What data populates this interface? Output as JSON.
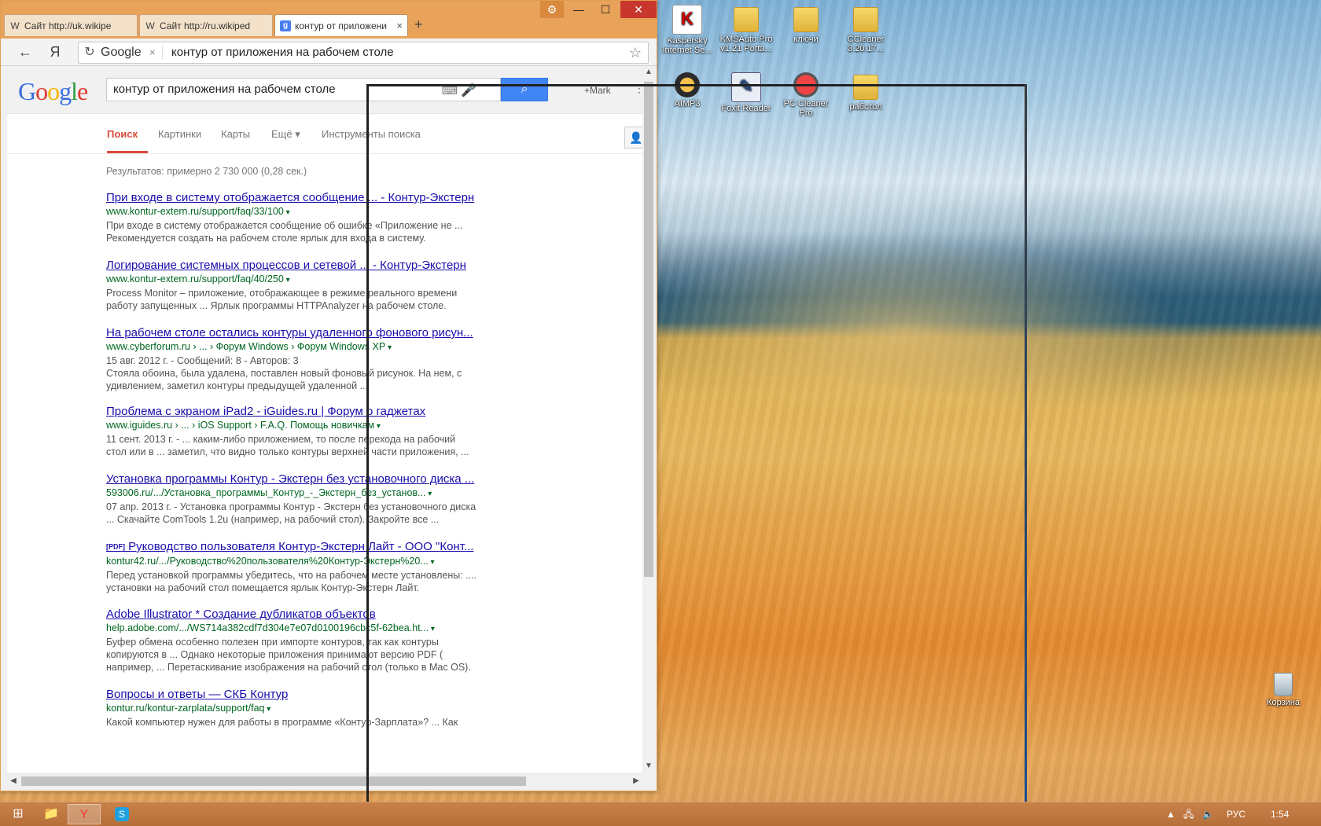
{
  "window": {
    "tabs": [
      {
        "label": "Сайт http://uk.wikipe",
        "favicon": "W"
      },
      {
        "label": "Сайт http://ru.wikiped",
        "favicon": "W"
      },
      {
        "label": "контур от приложени",
        "favicon": "g"
      }
    ],
    "new_tab": "+",
    "controls": {
      "settings": "⚙",
      "minimize": "—",
      "maximize": "☐",
      "close": "✕"
    }
  },
  "toolbar": {
    "back": "←",
    "yandex": "Я",
    "reload": "↻",
    "engine": "Google",
    "engine_clear": "×",
    "query": "контур от приложения на рабочем столе",
    "star": "☆"
  },
  "google": {
    "logo": [
      "G",
      "o",
      "o",
      "g",
      "l",
      "e"
    ],
    "query": "контур от приложения на рабочем столе",
    "plus": "+Mark",
    "nav": [
      "Поиск",
      "Картинки",
      "Карты",
      "Ещё ▾",
      "Инструменты поиска"
    ],
    "stats": "Результатов: примерно 2 730 000 (0,28 сек.)",
    "results": [
      {
        "title": "При входе в систему отображается сообщение ... - Контур-Экстерн",
        "url": "www.kontur-extern.ru/support/faq/33/100",
        "s1": "При входе в систему отображается сообщение об ошибке «Приложение не ...",
        "s2": "Рекомендуется создать на рабочем столе ярлык для входа в систему."
      },
      {
        "title": "Логирование системных процессов и сетевой ... - Контур-Экстерн",
        "url": "www.kontur-extern.ru/support/faq/40/250",
        "s1": "Process Monitor – приложение, отображающее в режиме реального времени",
        "s2": "работу запущенных ... Ярлык программы HTTPAnalyzer на рабочем столе."
      },
      {
        "title": "На рабочем столе остались контуры удаленного фонового рисун...",
        "url": "www.cyberforum.ru › ... › Форум Windows › Форум Windows XP",
        "s0": "15 авг. 2012 г. - Сообщений: 8 - Авторов: 3",
        "s1": "Стояла обоина, была удалена, поставлен новый фоновый рисунок. На нем, с",
        "s2": "удивлением, заметил контуры предыдущей удаленной ..."
      },
      {
        "title": "Проблема с экраном iPad2 - iGuides.ru | Форум о гаджетах",
        "url": "www.iguides.ru › ... › iOS Support › F.A.Q. Помощь новичкам",
        "s1": "11 сент. 2013 г. - ... каким-либо приложением, то после перехода на рабочий",
        "s2": "стол или в ... заметил, что видно только контуры верхней части приложения, ..."
      },
      {
        "title": "Установка программы Контур - Экстерн без установочного диска ...",
        "url": "593006.ru/.../Установка_программы_Контур_-_Экстерн_без_установ...",
        "s1": "07 апр. 2013 г. - Установка программы Контур - Экстерн без установочного диска",
        "s2": "... Скачайте ComTools 1.2u (например, на рабочий стол). Закройте все ..."
      },
      {
        "pdf": "[PDF]",
        "title": "Руководство пользователя Контур-Экстерн Лайт - ООО \"Конт...",
        "url": "kontur42.ru/.../Руководство%20пользователя%20Контур-Экстерн%20...",
        "s1": "Перед установкой программы убедитесь, что на рабочем месте установлены: ....",
        "s2": "установки на рабочий стол помещается ярлык Контур-Экстерн Лайт."
      },
      {
        "title": "Adobe Illustrator * Создание дубликатов объектов",
        "url": "help.adobe.com/.../WS714a382cdf7d304e7e07d0100196cbc5f-62bea.ht...",
        "s1": "Буфер обмена особенно полезен при импорте контуров, так как контуры",
        "s2": "копируются в ... Однако некоторые приложения принимают версию PDF (",
        "s3": "например, ... Перетаскивание изображения на рабочий стол (только в Mac OS)."
      },
      {
        "title": "Вопросы и ответы — СКБ Контур",
        "url": "kontur.ru/kontur-zarplata/support/faq",
        "s1": "Какой компьютер нужен для работы в программе «Контур-Зарплата»? ... Как"
      }
    ]
  },
  "desktop": {
    "icons": [
      {
        "label": "Kaspersky Internet Se...",
        "icon": "kaspersky-icon"
      },
      {
        "label": "KMSAuto Pro v1.21 Porta...",
        "icon": "folder-icon"
      },
      {
        "label": "ключи",
        "icon": "folder-icon"
      },
      {
        "label": "CCleaner 3.20.17...",
        "icon": "folder-icon"
      },
      {
        "label": "AIMP3",
        "icon": "aimp-icon"
      },
      {
        "label": "Foxit Reader",
        "icon": "foxit-icon"
      },
      {
        "label": "PC Cleaner Pro",
        "icon": "pccleaner-icon"
      },
      {
        "label": "рабстол",
        "icon": "folder-icon"
      },
      {
        "label": "Корзина",
        "icon": "recycle-bin-icon"
      }
    ]
  },
  "taskbar": {
    "lang": "РУС",
    "time": "1:54"
  }
}
